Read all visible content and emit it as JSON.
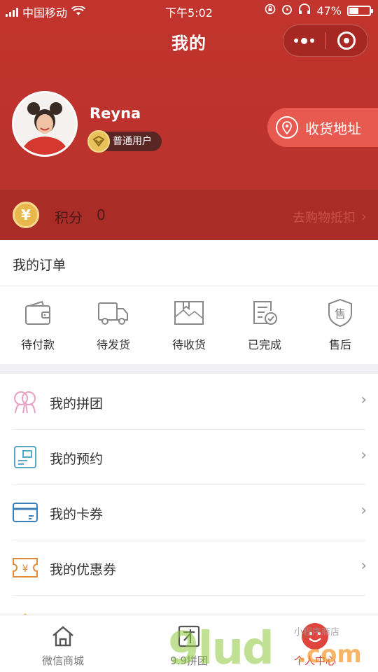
{
  "status_bar": {
    "carrier": "中国移动",
    "time": "下午5:02",
    "battery_percent": "47%",
    "battery_level": 0.47
  },
  "nav": {
    "title": "我的"
  },
  "profile": {
    "username": "Reyna",
    "level": "普通用户",
    "address_button": "收货地址"
  },
  "points": {
    "label": "积分",
    "value": "0",
    "link": "去购物抵扣",
    "coin_symbol": "¥"
  },
  "orders": {
    "title": "我的订单",
    "items": [
      {
        "label": "待付款",
        "icon": "wallet-icon"
      },
      {
        "label": "待发货",
        "icon": "truck-icon"
      },
      {
        "label": "待收货",
        "icon": "package-icon"
      },
      {
        "label": "已完成",
        "icon": "completed-doc-icon"
      },
      {
        "label": "售后",
        "icon": "after-sale-shield-icon"
      }
    ]
  },
  "menu": [
    {
      "label": "我的拼团",
      "icon": "group-buy-icon"
    },
    {
      "label": "我的预约",
      "icon": "reservation-icon"
    },
    {
      "label": "我的卡券",
      "icon": "card-icon"
    },
    {
      "label": "我的优惠券",
      "icon": "coupon-icon"
    }
  ],
  "tabbar": [
    {
      "label": "微信商城",
      "icon": "home-icon"
    },
    {
      "label": "9.9拼团",
      "icon": "group-tab-icon"
    },
    {
      "label": "个人中心",
      "icon": "smile-icon"
    }
  ],
  "watermark": {
    "text": "9lud",
    "suffix": ".com",
    "small": "小程序商店"
  },
  "colors": {
    "brand_red": "#c2342e",
    "address_pill": "#e85a50",
    "coin_gold": "#e8b84c"
  }
}
